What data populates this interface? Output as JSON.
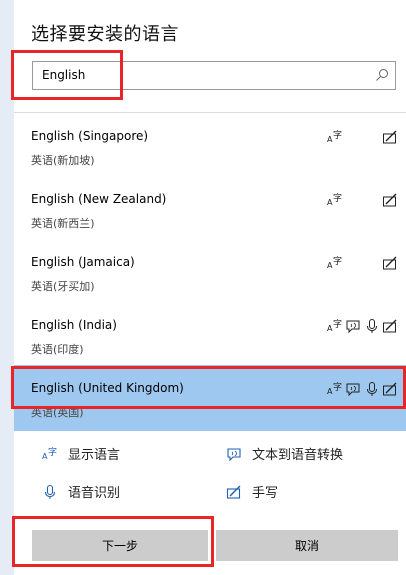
{
  "title": "选择要安装的语言",
  "search": {
    "value": "English",
    "placeholder": ""
  },
  "languages": [
    {
      "name": "English (Singapore)",
      "native": "英语(新加坡)",
      "features": [
        "display-language",
        "handwriting"
      ]
    },
    {
      "name": "English (New Zealand)",
      "native": "英语(新西兰)",
      "features": [
        "display-language",
        "handwriting"
      ]
    },
    {
      "name": "English (Jamaica)",
      "native": "英语(牙买加)",
      "features": [
        "display-language",
        "handwriting"
      ]
    },
    {
      "name": "English (India)",
      "native": "英语(印度)",
      "features": [
        "display-language",
        "text-to-speech",
        "speech",
        "handwriting"
      ]
    },
    {
      "name": "English (United Kingdom)",
      "native": "英语(英国)",
      "features": [
        "display-language",
        "text-to-speech",
        "speech",
        "handwriting"
      ],
      "selected": true
    }
  ],
  "legend": {
    "display_language": "显示语言",
    "text_to_speech": "文本到语音转换",
    "speech_recognition": "语音识别",
    "handwriting": "手写"
  },
  "buttons": {
    "next": "下一步",
    "cancel": "取消"
  },
  "colors": {
    "selected": "#9ec8ef",
    "highlight_box": "#e8262a",
    "icon": "#1e5fb4"
  }
}
